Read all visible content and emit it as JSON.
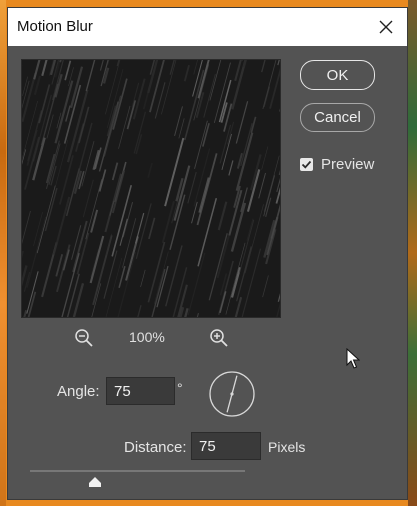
{
  "dialog": {
    "title": "Motion Blur",
    "close_icon": "close-icon"
  },
  "buttons": {
    "ok": "OK",
    "cancel": "Cancel"
  },
  "preview_toggle": {
    "label": "Preview",
    "checked": true
  },
  "zoom": {
    "level": "100%",
    "zoom_out_icon": "zoom-out-icon",
    "zoom_in_icon": "zoom-in-icon"
  },
  "angle": {
    "label": "Angle:",
    "value": "75",
    "unit": "°",
    "dial_icon": "angle-dial-icon"
  },
  "distance": {
    "label": "Distance:",
    "value": "75",
    "unit": "Pixels",
    "slider_fraction": 0.3
  },
  "colors": {
    "dialog_bg": "#535353",
    "titlebar_bg": "#ffffff",
    "frame_orange": "#e8891f"
  }
}
